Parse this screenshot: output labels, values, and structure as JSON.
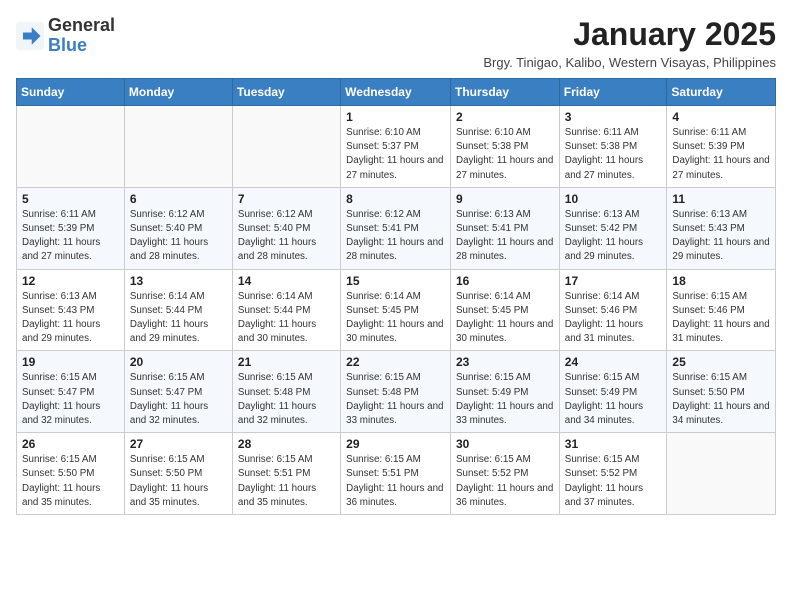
{
  "header": {
    "logo_general": "General",
    "logo_blue": "Blue",
    "month_title": "January 2025",
    "subtitle": "Brgy. Tinigao, Kalibo, Western Visayas, Philippines"
  },
  "weekdays": [
    "Sunday",
    "Monday",
    "Tuesday",
    "Wednesday",
    "Thursday",
    "Friday",
    "Saturday"
  ],
  "weeks": [
    [
      {
        "day": "",
        "info": ""
      },
      {
        "day": "",
        "info": ""
      },
      {
        "day": "",
        "info": ""
      },
      {
        "day": "1",
        "info": "Sunrise: 6:10 AM\nSunset: 5:37 PM\nDaylight: 11 hours and 27 minutes."
      },
      {
        "day": "2",
        "info": "Sunrise: 6:10 AM\nSunset: 5:38 PM\nDaylight: 11 hours and 27 minutes."
      },
      {
        "day": "3",
        "info": "Sunrise: 6:11 AM\nSunset: 5:38 PM\nDaylight: 11 hours and 27 minutes."
      },
      {
        "day": "4",
        "info": "Sunrise: 6:11 AM\nSunset: 5:39 PM\nDaylight: 11 hours and 27 minutes."
      }
    ],
    [
      {
        "day": "5",
        "info": "Sunrise: 6:11 AM\nSunset: 5:39 PM\nDaylight: 11 hours and 27 minutes."
      },
      {
        "day": "6",
        "info": "Sunrise: 6:12 AM\nSunset: 5:40 PM\nDaylight: 11 hours and 28 minutes."
      },
      {
        "day": "7",
        "info": "Sunrise: 6:12 AM\nSunset: 5:40 PM\nDaylight: 11 hours and 28 minutes."
      },
      {
        "day": "8",
        "info": "Sunrise: 6:12 AM\nSunset: 5:41 PM\nDaylight: 11 hours and 28 minutes."
      },
      {
        "day": "9",
        "info": "Sunrise: 6:13 AM\nSunset: 5:41 PM\nDaylight: 11 hours and 28 minutes."
      },
      {
        "day": "10",
        "info": "Sunrise: 6:13 AM\nSunset: 5:42 PM\nDaylight: 11 hours and 29 minutes."
      },
      {
        "day": "11",
        "info": "Sunrise: 6:13 AM\nSunset: 5:43 PM\nDaylight: 11 hours and 29 minutes."
      }
    ],
    [
      {
        "day": "12",
        "info": "Sunrise: 6:13 AM\nSunset: 5:43 PM\nDaylight: 11 hours and 29 minutes."
      },
      {
        "day": "13",
        "info": "Sunrise: 6:14 AM\nSunset: 5:44 PM\nDaylight: 11 hours and 29 minutes."
      },
      {
        "day": "14",
        "info": "Sunrise: 6:14 AM\nSunset: 5:44 PM\nDaylight: 11 hours and 30 minutes."
      },
      {
        "day": "15",
        "info": "Sunrise: 6:14 AM\nSunset: 5:45 PM\nDaylight: 11 hours and 30 minutes."
      },
      {
        "day": "16",
        "info": "Sunrise: 6:14 AM\nSunset: 5:45 PM\nDaylight: 11 hours and 30 minutes."
      },
      {
        "day": "17",
        "info": "Sunrise: 6:14 AM\nSunset: 5:46 PM\nDaylight: 11 hours and 31 minutes."
      },
      {
        "day": "18",
        "info": "Sunrise: 6:15 AM\nSunset: 5:46 PM\nDaylight: 11 hours and 31 minutes."
      }
    ],
    [
      {
        "day": "19",
        "info": "Sunrise: 6:15 AM\nSunset: 5:47 PM\nDaylight: 11 hours and 32 minutes."
      },
      {
        "day": "20",
        "info": "Sunrise: 6:15 AM\nSunset: 5:47 PM\nDaylight: 11 hours and 32 minutes."
      },
      {
        "day": "21",
        "info": "Sunrise: 6:15 AM\nSunset: 5:48 PM\nDaylight: 11 hours and 32 minutes."
      },
      {
        "day": "22",
        "info": "Sunrise: 6:15 AM\nSunset: 5:48 PM\nDaylight: 11 hours and 33 minutes."
      },
      {
        "day": "23",
        "info": "Sunrise: 6:15 AM\nSunset: 5:49 PM\nDaylight: 11 hours and 33 minutes."
      },
      {
        "day": "24",
        "info": "Sunrise: 6:15 AM\nSunset: 5:49 PM\nDaylight: 11 hours and 34 minutes."
      },
      {
        "day": "25",
        "info": "Sunrise: 6:15 AM\nSunset: 5:50 PM\nDaylight: 11 hours and 34 minutes."
      }
    ],
    [
      {
        "day": "26",
        "info": "Sunrise: 6:15 AM\nSunset: 5:50 PM\nDaylight: 11 hours and 35 minutes."
      },
      {
        "day": "27",
        "info": "Sunrise: 6:15 AM\nSunset: 5:50 PM\nDaylight: 11 hours and 35 minutes."
      },
      {
        "day": "28",
        "info": "Sunrise: 6:15 AM\nSunset: 5:51 PM\nDaylight: 11 hours and 35 minutes."
      },
      {
        "day": "29",
        "info": "Sunrise: 6:15 AM\nSunset: 5:51 PM\nDaylight: 11 hours and 36 minutes."
      },
      {
        "day": "30",
        "info": "Sunrise: 6:15 AM\nSunset: 5:52 PM\nDaylight: 11 hours and 36 minutes."
      },
      {
        "day": "31",
        "info": "Sunrise: 6:15 AM\nSunset: 5:52 PM\nDaylight: 11 hours and 37 minutes."
      },
      {
        "day": "",
        "info": ""
      }
    ]
  ]
}
